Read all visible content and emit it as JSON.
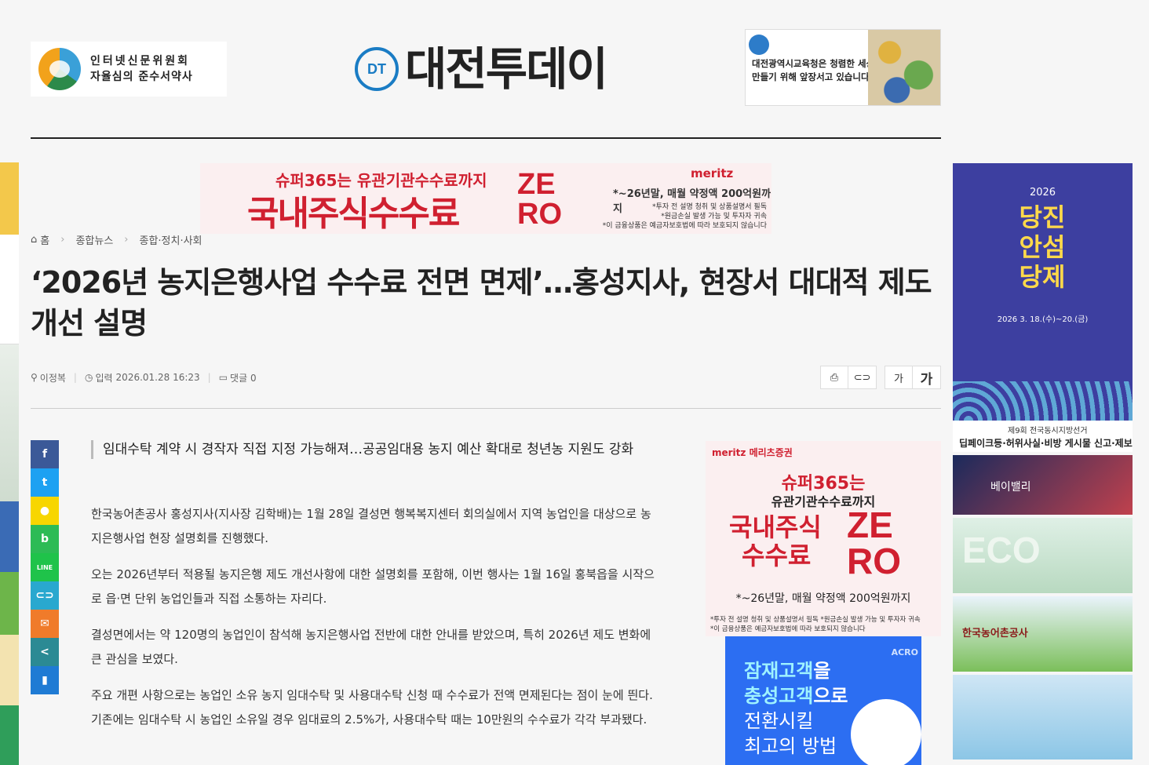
{
  "header": {
    "press_badge": {
      "line1": "인터넷신문위원회",
      "line2": "자율심의 준수서약사"
    },
    "brand": {
      "mark": "DT",
      "name": "대전투데이"
    },
    "edu_ad": {
      "line1": "대전광역시교육청은 청렴한 세상을",
      "line2": "만들기 위해 앞장서고 있습니다."
    }
  },
  "top_banner": {
    "brand": "meritz",
    "line1": "슈퍼365는 유관기관수수료까지",
    "line2": "국내주식수수료",
    "zero_top": "ZE",
    "zero_bottom": "RO",
    "main": "*~26년말, 매월 약정액 200억원까지",
    "small1": "*투자 전 설명 청취 및 상품설명서 필독",
    "small2": "*원금손실 발생 가능 및 투자자 귀속",
    "small3": "*이 금융상품은 예금자보호법에 따라 보호되지 않습니다"
  },
  "breadcrumb": {
    "home": "홈",
    "level1": "종합뉴스",
    "level2": "종합·정치·사회"
  },
  "article": {
    "title": "‘2026년 농지은행사업 수수료 전면 면제’…홍성지사, 현장서 대대적 제도 개선 설명",
    "author": "이정복",
    "date_label": "입력",
    "date": "2026.01.28 16:23",
    "comments": "댓글 0",
    "subtitle": "임대수탁 계약 시 경작자 직접 지정 가능해져…공공임대용 농지 예산 확대로 청년농 지원도 강화",
    "paragraphs": [
      "한국농어촌공사 홍성지사(지사장 김학배)는 1월 28일 결성면 행복복지센터 회의실에서 지역 농업인을 대상으로 농지은행사업 현장 설명회를 진행했다.",
      "오는 2026년부터 적용될 농지은행 제도 개선사항에 대한 설명회를 포함해, 이번 행사는 1월 16일 홍북읍을 시작으로 읍·면 단위 농업인들과 직접 소통하는 자리다.",
      "결성면에서는 약 120명의 농업인이 참석해 농지은행사업 전반에 대한 안내를 받았으며, 특히 2026년 제도 변화에 큰 관심을 보였다.",
      "주요 개편 사항으로는 농업인 소유 농지 임대수탁 및 사용대수탁 신청 때 수수료가 전액 면제된다는 점이 눈에 띈다. 기존에는 임대수탁 시 농업인 소유일 경우 임대료의 2.5%가, 사용대수탁 때는 10만원의 수수료가 각각 부과됐다."
    ]
  },
  "tools": {
    "print_icon": "print-icon",
    "link_icon": "link-icon",
    "font_small": "가",
    "font_large": "가"
  },
  "share": [
    {
      "icon": "facebook-icon",
      "glyph": "f",
      "color": "#3b5998"
    },
    {
      "icon": "twitter-icon",
      "glyph": "t",
      "color": "#1da1f2"
    },
    {
      "icon": "kakaotalk-icon",
      "glyph": "●",
      "color": "#f7d600"
    },
    {
      "icon": "band-icon",
      "glyph": "b",
      "color": "#2dbb55"
    },
    {
      "icon": "line-icon",
      "glyph": "LINE",
      "color": "#1fc34a"
    },
    {
      "icon": "link-icon",
      "glyph": "⊂⊃",
      "color": "#29a8cf"
    },
    {
      "icon": "email-icon",
      "glyph": "✉",
      "color": "#f07b2a"
    },
    {
      "icon": "share-icon",
      "glyph": "<",
      "color": "#2b8a94"
    },
    {
      "icon": "bookmark-icon",
      "glyph": "▮",
      "color": "#1f7bd4"
    }
  ],
  "side_ad": {
    "brand": "meritz 메리츠증권",
    "line1": "슈퍼365는",
    "line2": "유관기관수수료까지",
    "big1": "국내주식",
    "big2": "수수료",
    "zero_top": "ZE",
    "zero_bottom": "RO",
    "amount": "*~26년말, 매월 약정액 200억원까지",
    "small1": "*투자 전 설명 청취 및 상품설명서 필독 *원금손실 발생 가능 및 투자자 귀속",
    "small2": "*이 금융상품은 예금자보호법에 따라 보호되지 않습니다"
  },
  "acro_ad": {
    "brand": "ACRO",
    "line1a": "잠재고객",
    "line1b": "을",
    "line2a": "충성고객",
    "line2b": "으로",
    "line3": "전환시킬",
    "line4": "최고의 방법"
  },
  "right_ads": {
    "poster": {
      "year": "2026",
      "title": "당진 안섬 당제",
      "date": "2026 3. 18.(수)~20.(금)"
    },
    "election": {
      "line1": "제9회 전국동시지방선거",
      "line2": "딥페이크등·허위사실·비방 게시물 신고·제보"
    },
    "tile1": "베이밸리",
    "tile2": "ECO",
    "tile3": "한국농어촌공사"
  }
}
